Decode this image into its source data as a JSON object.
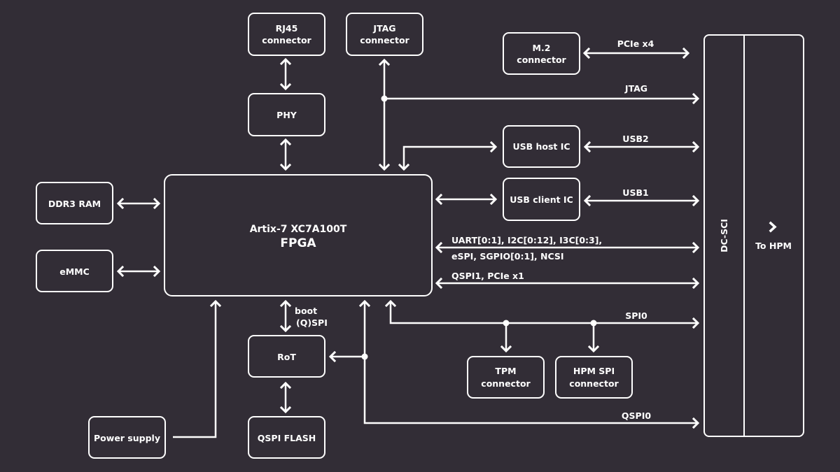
{
  "colors": {
    "background": "#322d36",
    "foreground": "#ffffff"
  },
  "blocks": {
    "rj45": {
      "line1": "RJ45",
      "line2": "connector"
    },
    "jtag_connector": {
      "line1": "JTAG",
      "line2": "connector"
    },
    "m2": {
      "line1": "M.2",
      "line2": "connector"
    },
    "phy": {
      "label": "PHY"
    },
    "usb_host": {
      "label": "USB host IC"
    },
    "usb_client": {
      "label": "USB client IC"
    },
    "ddr3": {
      "label": "DDR3 RAM"
    },
    "emmc": {
      "label": "eMMC"
    },
    "fpga": {
      "line1": "Artix-7 XC7A100T",
      "line2": "FPGA"
    },
    "rot": {
      "label": "RoT"
    },
    "qspi_flash": {
      "label": "QSPI FLASH"
    },
    "power_supply": {
      "label": "Power supply"
    },
    "tpm": {
      "line1": "TPM",
      "line2": "connector"
    },
    "hpm_spi": {
      "line1": "HPM SPI",
      "line2": "connector"
    },
    "dcsci": {
      "label": "DC-SCI",
      "side_label": "To HPM",
      "side_icon": "chevron-right-icon"
    }
  },
  "signals": {
    "pcie_x4": "PCIe x4",
    "jtag": "JTAG",
    "usb2": "USB2",
    "usb1": "USB1",
    "misc_line1": "UART[0:1], I2C[0:12], I3C[0:3],",
    "misc_line2": "eSPI, SGPIO[0:1], NCSI",
    "qspi1_pcie": "QSPI1, PCIe x1",
    "spi0": "SPI0",
    "qspi0": "QSPI0",
    "boot_line1": "boot",
    "boot_line2": "(Q)SPI"
  }
}
